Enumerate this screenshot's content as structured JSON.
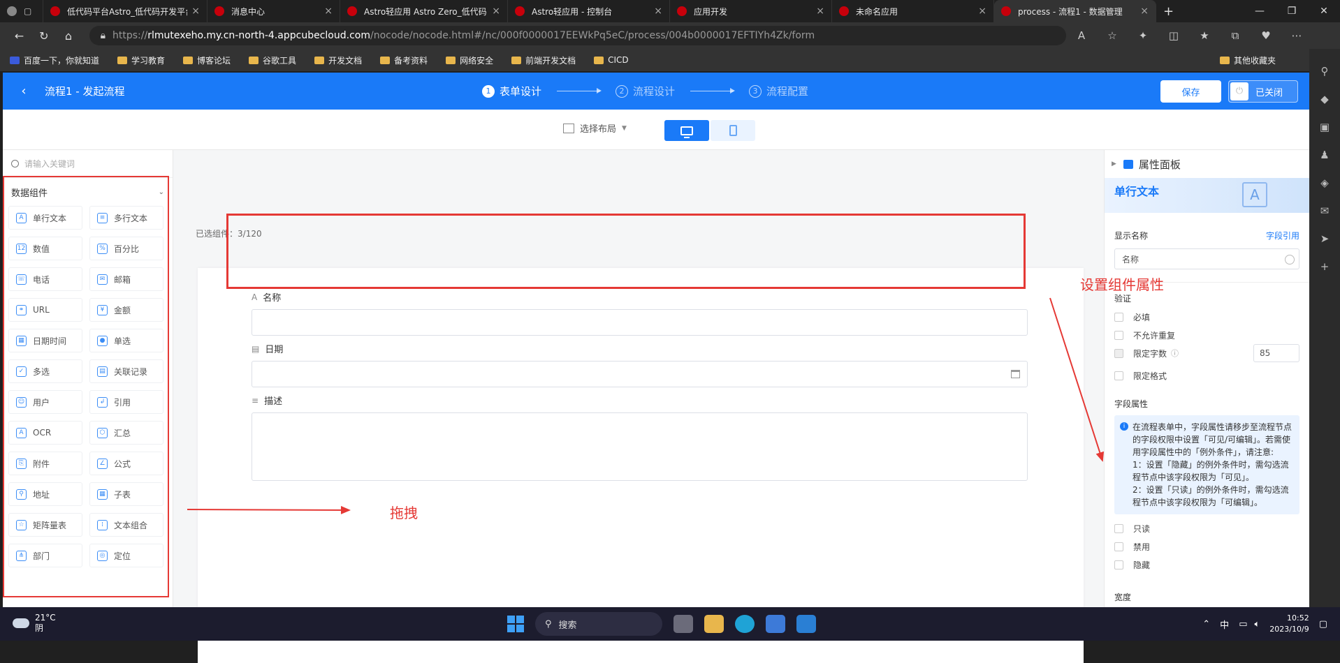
{
  "browser": {
    "tabs": [
      {
        "title": "低代码平台Astro_低代码开发平台",
        "active": false
      },
      {
        "title": "消息中心",
        "active": false
      },
      {
        "title": "Astro轻应用 Astro Zero_低代码",
        "active": false
      },
      {
        "title": "Astro轻应用 - 控制台",
        "active": false
      },
      {
        "title": "应用开发",
        "active": false
      },
      {
        "title": "未命名应用",
        "active": false
      },
      {
        "title": "process - 流程1 - 数据管理",
        "active": true
      }
    ],
    "url_prefix": "https://",
    "url_host": "rlmutexeho.my.cn-north-4.appcubecloud.com",
    "url_path": "/nocode/nocode.html#/nc/000f0000017EEWkPq5eC/process/004b0000017EFTIYh4Zk/form",
    "bookmarks": [
      "百度一下，你就知道",
      "学习教育",
      "博客论坛",
      "谷歌工具",
      "开发文档",
      "备考资料",
      "网络安全",
      "前端开发文档",
      "CICD"
    ],
    "bookmarks_other": "其他收藏夹"
  },
  "header": {
    "title": "流程1 - 发起流程",
    "steps": [
      {
        "num": "1",
        "label": "表单设计",
        "current": true
      },
      {
        "num": "2",
        "label": "流程设计",
        "current": false
      },
      {
        "num": "3",
        "label": "流程配置",
        "current": false
      }
    ],
    "save_label": "保存",
    "closed_label": "已关闭"
  },
  "toolbar": {
    "layout_label": "选择布局"
  },
  "left": {
    "search_placeholder": "请输入关键词",
    "group_title": "数据组件",
    "components": [
      {
        "label": "单行文本",
        "icon": "A"
      },
      {
        "label": "多行文本",
        "icon": "≡"
      },
      {
        "label": "数值",
        "icon": "12"
      },
      {
        "label": "百分比",
        "icon": "%"
      },
      {
        "label": "电话",
        "icon": "☏"
      },
      {
        "label": "邮箱",
        "icon": "✉"
      },
      {
        "label": "URL",
        "icon": "⚭"
      },
      {
        "label": "金额",
        "icon": "¥"
      },
      {
        "label": "日期时间",
        "icon": "▦"
      },
      {
        "label": "单选",
        "icon": "●"
      },
      {
        "label": "多选",
        "icon": "✓"
      },
      {
        "label": "关联记录",
        "icon": "▤"
      },
      {
        "label": "用户",
        "icon": "☺"
      },
      {
        "label": "引用",
        "icon": "↲"
      },
      {
        "label": "OCR",
        "icon": "A"
      },
      {
        "label": "汇总",
        "icon": "⬡"
      },
      {
        "label": "附件",
        "icon": "⎘"
      },
      {
        "label": "公式",
        "icon": "∠"
      },
      {
        "label": "地址",
        "icon": "⚲"
      },
      {
        "label": "子表",
        "icon": "▦"
      },
      {
        "label": "矩阵量表",
        "icon": "☆"
      },
      {
        "label": "文本组合",
        "icon": "⁞"
      },
      {
        "label": "部门",
        "icon": "⋔"
      },
      {
        "label": "定位",
        "icon": "◎"
      }
    ]
  },
  "canvas": {
    "selected_count_label": "已选组件：",
    "selected_count": "3/120",
    "fields": [
      {
        "label": "名称",
        "icon": "A",
        "type": "text"
      },
      {
        "label": "日期",
        "icon": "▤",
        "type": "date"
      },
      {
        "label": "描述",
        "icon": "≡",
        "type": "textarea"
      }
    ]
  },
  "annotations": {
    "set_props": "设置组件属性",
    "drag": "拖拽"
  },
  "props": {
    "panel_title": "属性面板",
    "component_name": "单行文本",
    "display_name_label": "显示名称",
    "field_ref_link": "字段引用",
    "display_name_value": "名称",
    "validation_title": "验证",
    "validation": [
      {
        "label": "必填",
        "checked": false
      },
      {
        "label": "不允许重复",
        "checked": false
      },
      {
        "label": "限定字数",
        "checked": true
      },
      {
        "label": "限定格式",
        "checked": false
      }
    ],
    "limit_value": "85",
    "field_props_title": "字段属性",
    "info_text_1": "在流程表单中，字段属性请移步至流程节点的字段权限中设置「可见/可编辑」。若需使用字段属性中的「例外条件」，请注意:",
    "info_text_2": "1：设置「隐藏」的例外条件时，需勾选流程节点中该字段权限为「可见」。",
    "info_text_3": "2：设置「只读」的例外条件时，需勾选流程节点中该字段权限为「可编辑」。",
    "field_attrs": [
      "只读",
      "禁用",
      "隐藏"
    ],
    "bottom_cut": "宽度"
  },
  "taskbar": {
    "temperature": "21°C",
    "weather": "阴",
    "search_label": "搜索",
    "ime": "中",
    "time": "10:52",
    "date": "2023/10/9"
  }
}
